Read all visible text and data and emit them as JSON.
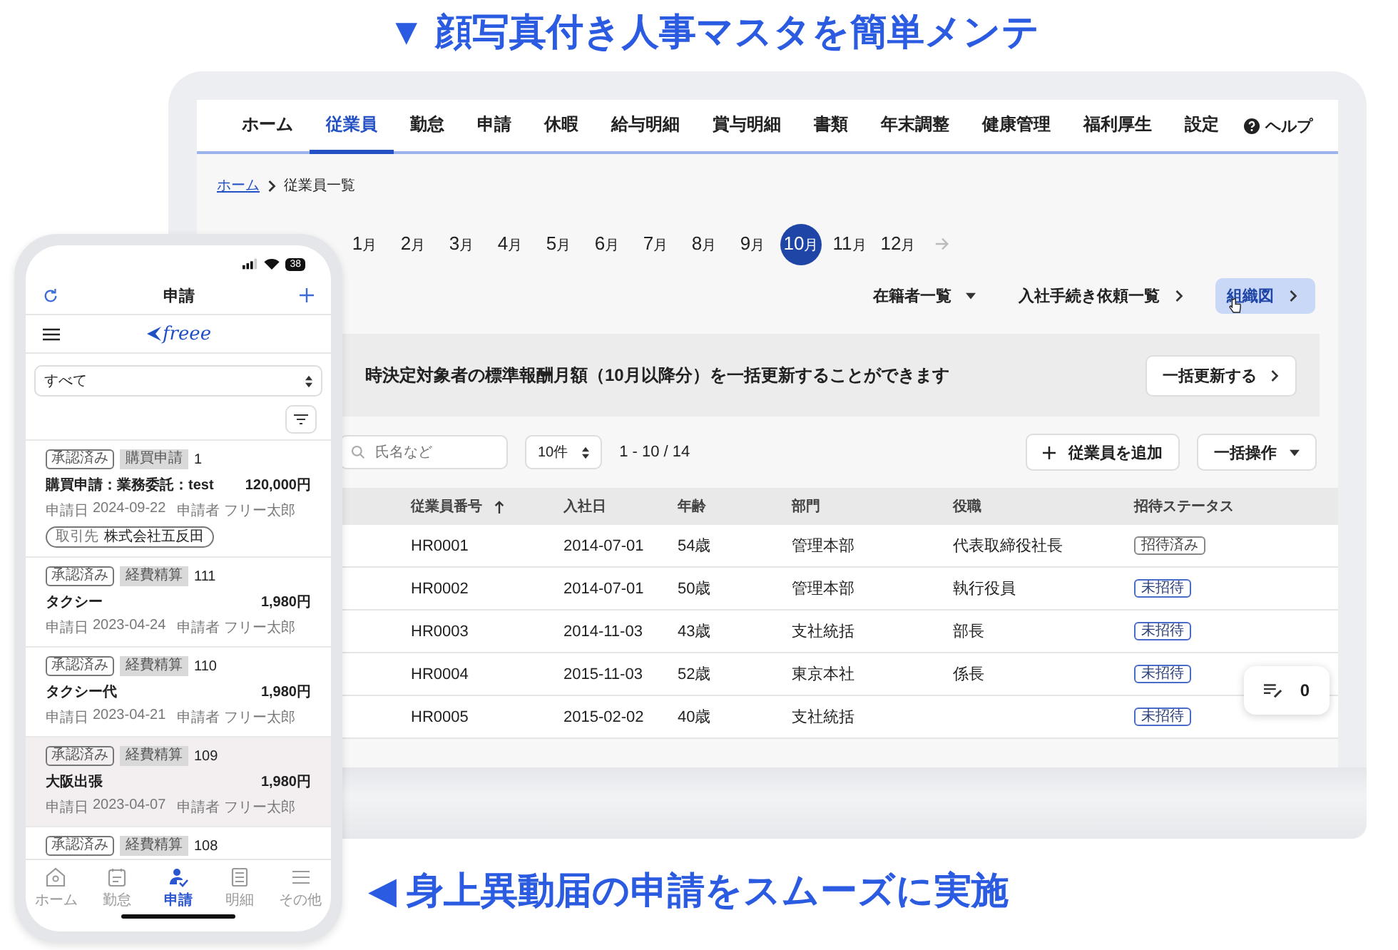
{
  "headline_top": "▼ 顔写真付き人事マスタを簡単メンテ",
  "headline_bottom": "◀ 身上異動届の申請をスムーズに実施",
  "laptop": {
    "nav": {
      "tabs": [
        {
          "label": "ホーム",
          "selected": false
        },
        {
          "label": "従業員",
          "selected": true
        },
        {
          "label": "勤怠",
          "selected": false
        },
        {
          "label": "申請",
          "selected": false
        },
        {
          "label": "休暇",
          "selected": false
        },
        {
          "label": "給与明細",
          "selected": false
        },
        {
          "label": "賞与明細",
          "selected": false
        },
        {
          "label": "書類",
          "selected": false
        },
        {
          "label": "年末調整",
          "selected": false
        },
        {
          "label": "健康管理",
          "selected": false
        },
        {
          "label": "福利厚生",
          "selected": false
        },
        {
          "label": "設定",
          "selected": false
        }
      ],
      "help": "ヘルプ"
    },
    "breadcrumb": {
      "home": "ホーム",
      "current": "従業員一覧"
    },
    "months": [
      {
        "number": "1",
        "unit": "月",
        "selected": false
      },
      {
        "number": "2",
        "unit": "月",
        "selected": false
      },
      {
        "number": "3",
        "unit": "月",
        "selected": false
      },
      {
        "number": "4",
        "unit": "月",
        "selected": false
      },
      {
        "number": "5",
        "unit": "月",
        "selected": false
      },
      {
        "number": "6",
        "unit": "月",
        "selected": false
      },
      {
        "number": "7",
        "unit": "月",
        "selected": false
      },
      {
        "number": "8",
        "unit": "月",
        "selected": false
      },
      {
        "number": "9",
        "unit": "月",
        "selected": false
      },
      {
        "number": "10",
        "unit": "月",
        "selected": true
      },
      {
        "number": "11",
        "unit": "月",
        "selected": false
      },
      {
        "number": "12",
        "unit": "月",
        "selected": false
      }
    ],
    "links": [
      {
        "label": "在籍者一覧",
        "kind": "dropdown",
        "hovered": false
      },
      {
        "label": "入社手続き依頼一覧",
        "kind": "link",
        "hovered": false
      },
      {
        "label": "組織図",
        "kind": "link",
        "hovered": true
      }
    ],
    "banner": {
      "message": "時決定対象者の標準報酬月額（10月以降分）を一括更新することができます",
      "button": "一括更新する"
    },
    "toolbar": {
      "search_placeholder": "氏名など",
      "page_size": "10件",
      "range": "1 - 10 / 14",
      "add_button": "従業員を追加",
      "bulk_button": "一括操作"
    },
    "table": {
      "columns": [
        {
          "label": "従業員番号",
          "sorted": true
        },
        {
          "label": "入社日",
          "sorted": false
        },
        {
          "label": "年齢",
          "sorted": false
        },
        {
          "label": "部門",
          "sorted": false
        },
        {
          "label": "役職",
          "sorted": false
        },
        {
          "label": "招待ステータス",
          "sorted": false
        }
      ],
      "rows": [
        {
          "id": "HR0001",
          "hire_date": "2014-07-01",
          "age": "54歳",
          "department": "管理本部",
          "title": "代表取締役社長",
          "status": "招待済み",
          "invited": true
        },
        {
          "id": "HR0002",
          "hire_date": "2014-07-01",
          "age": "50歳",
          "department": "管理本部",
          "title": "執行役員",
          "status": "未招待",
          "invited": false
        },
        {
          "id": "HR0003",
          "hire_date": "2014-11-03",
          "age": "43歳",
          "department": "支社統括",
          "title": "部長",
          "status": "未招待",
          "invited": false
        },
        {
          "id": "HR0004",
          "hire_date": "2015-11-03",
          "age": "52歳",
          "department": "東京本社",
          "title": "係長",
          "status": "未招待",
          "invited": false
        },
        {
          "id": "HR0005",
          "hire_date": "2015-02-02",
          "age": "40歳",
          "department": "支社統括",
          "status": "未招待",
          "invited": false
        }
      ]
    },
    "float_button": {
      "count": "0"
    }
  },
  "phone": {
    "battery": "38",
    "title": "申請",
    "logo": "freee",
    "filter_select": "すべて",
    "items": [
      {
        "status": "承認済み",
        "type": "購買申請",
        "number": "1",
        "title": "購買申請：業務委託：test",
        "amount": "120,000円",
        "date_label": "申請日",
        "date": "2024-09-22",
        "applicant_label": "申請者",
        "applicant": "フリー太郎",
        "partner_label": "取引先",
        "partner": "株式会社五反田",
        "selected": false
      },
      {
        "status": "承認済み",
        "type": "経費精算",
        "number": "111",
        "title": "タクシー",
        "amount": "1,980円",
        "date_label": "申請日",
        "date": "2023-04-24",
        "applicant_label": "申請者",
        "applicant": "フリー太郎",
        "selected": false
      },
      {
        "status": "承認済み",
        "type": "経費精算",
        "number": "110",
        "title": "タクシー代",
        "amount": "1,980円",
        "date_label": "申請日",
        "date": "2023-04-21",
        "applicant_label": "申請者",
        "applicant": "フリー太郎",
        "selected": false
      },
      {
        "status": "承認済み",
        "type": "経費精算",
        "number": "109",
        "title": "大阪出張",
        "amount": "1,980円",
        "date_label": "申請日",
        "date": "2023-04-07",
        "applicant_label": "申請者",
        "applicant": "フリー太郎",
        "selected": true
      },
      {
        "status": "承認済み",
        "type": "経費精算",
        "number": "108",
        "selected": false
      }
    ],
    "tabs": [
      {
        "label": "ホーム",
        "kind": "home",
        "selected": false
      },
      {
        "label": "勤怠",
        "kind": "calendar",
        "selected": false
      },
      {
        "label": "申請",
        "kind": "apply",
        "selected": true
      },
      {
        "label": "明細",
        "kind": "document",
        "selected": false
      },
      {
        "label": "その他",
        "kind": "menu",
        "selected": false
      }
    ]
  }
}
